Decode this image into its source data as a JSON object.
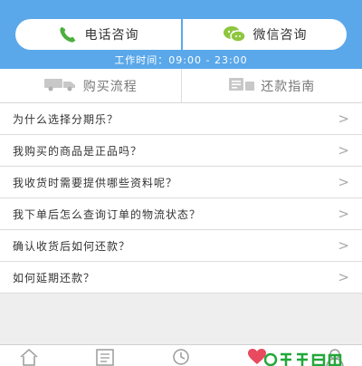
{
  "header": {
    "phone_label": "电话咨询",
    "wechat_label": "微信咨询",
    "hours": "工作时间：09:00 - 23:00"
  },
  "tabs": [
    {
      "label": "购买流程",
      "icon": "truck-icon"
    },
    {
      "label": "还款指南",
      "icon": "bill-icon"
    }
  ],
  "faq": [
    {
      "question": "为什么选择分期乐？"
    },
    {
      "question": "我购买的商品是正品吗？"
    },
    {
      "question": "我收货时需要提供哪些资料呢？"
    },
    {
      "question": "我下单后怎么查询订单的物流状态？"
    },
    {
      "question": "确认收货后如何还款？"
    },
    {
      "question": "如何延期还款？"
    }
  ],
  "bottom_nav": {
    "items": [
      {
        "icon": "home-icon"
      },
      {
        "icon": "list-icon"
      },
      {
        "icon": "clock-icon"
      },
      {
        "icon": "heart-icon"
      },
      {
        "icon": "user-icon"
      }
    ]
  },
  "colors": {
    "header_blue": "#5aa8ea",
    "phone_green": "#4caf3e",
    "wechat_green": "#8ec63f",
    "heart_red": "#e84a5f",
    "watermark_green": "#22a83a"
  }
}
